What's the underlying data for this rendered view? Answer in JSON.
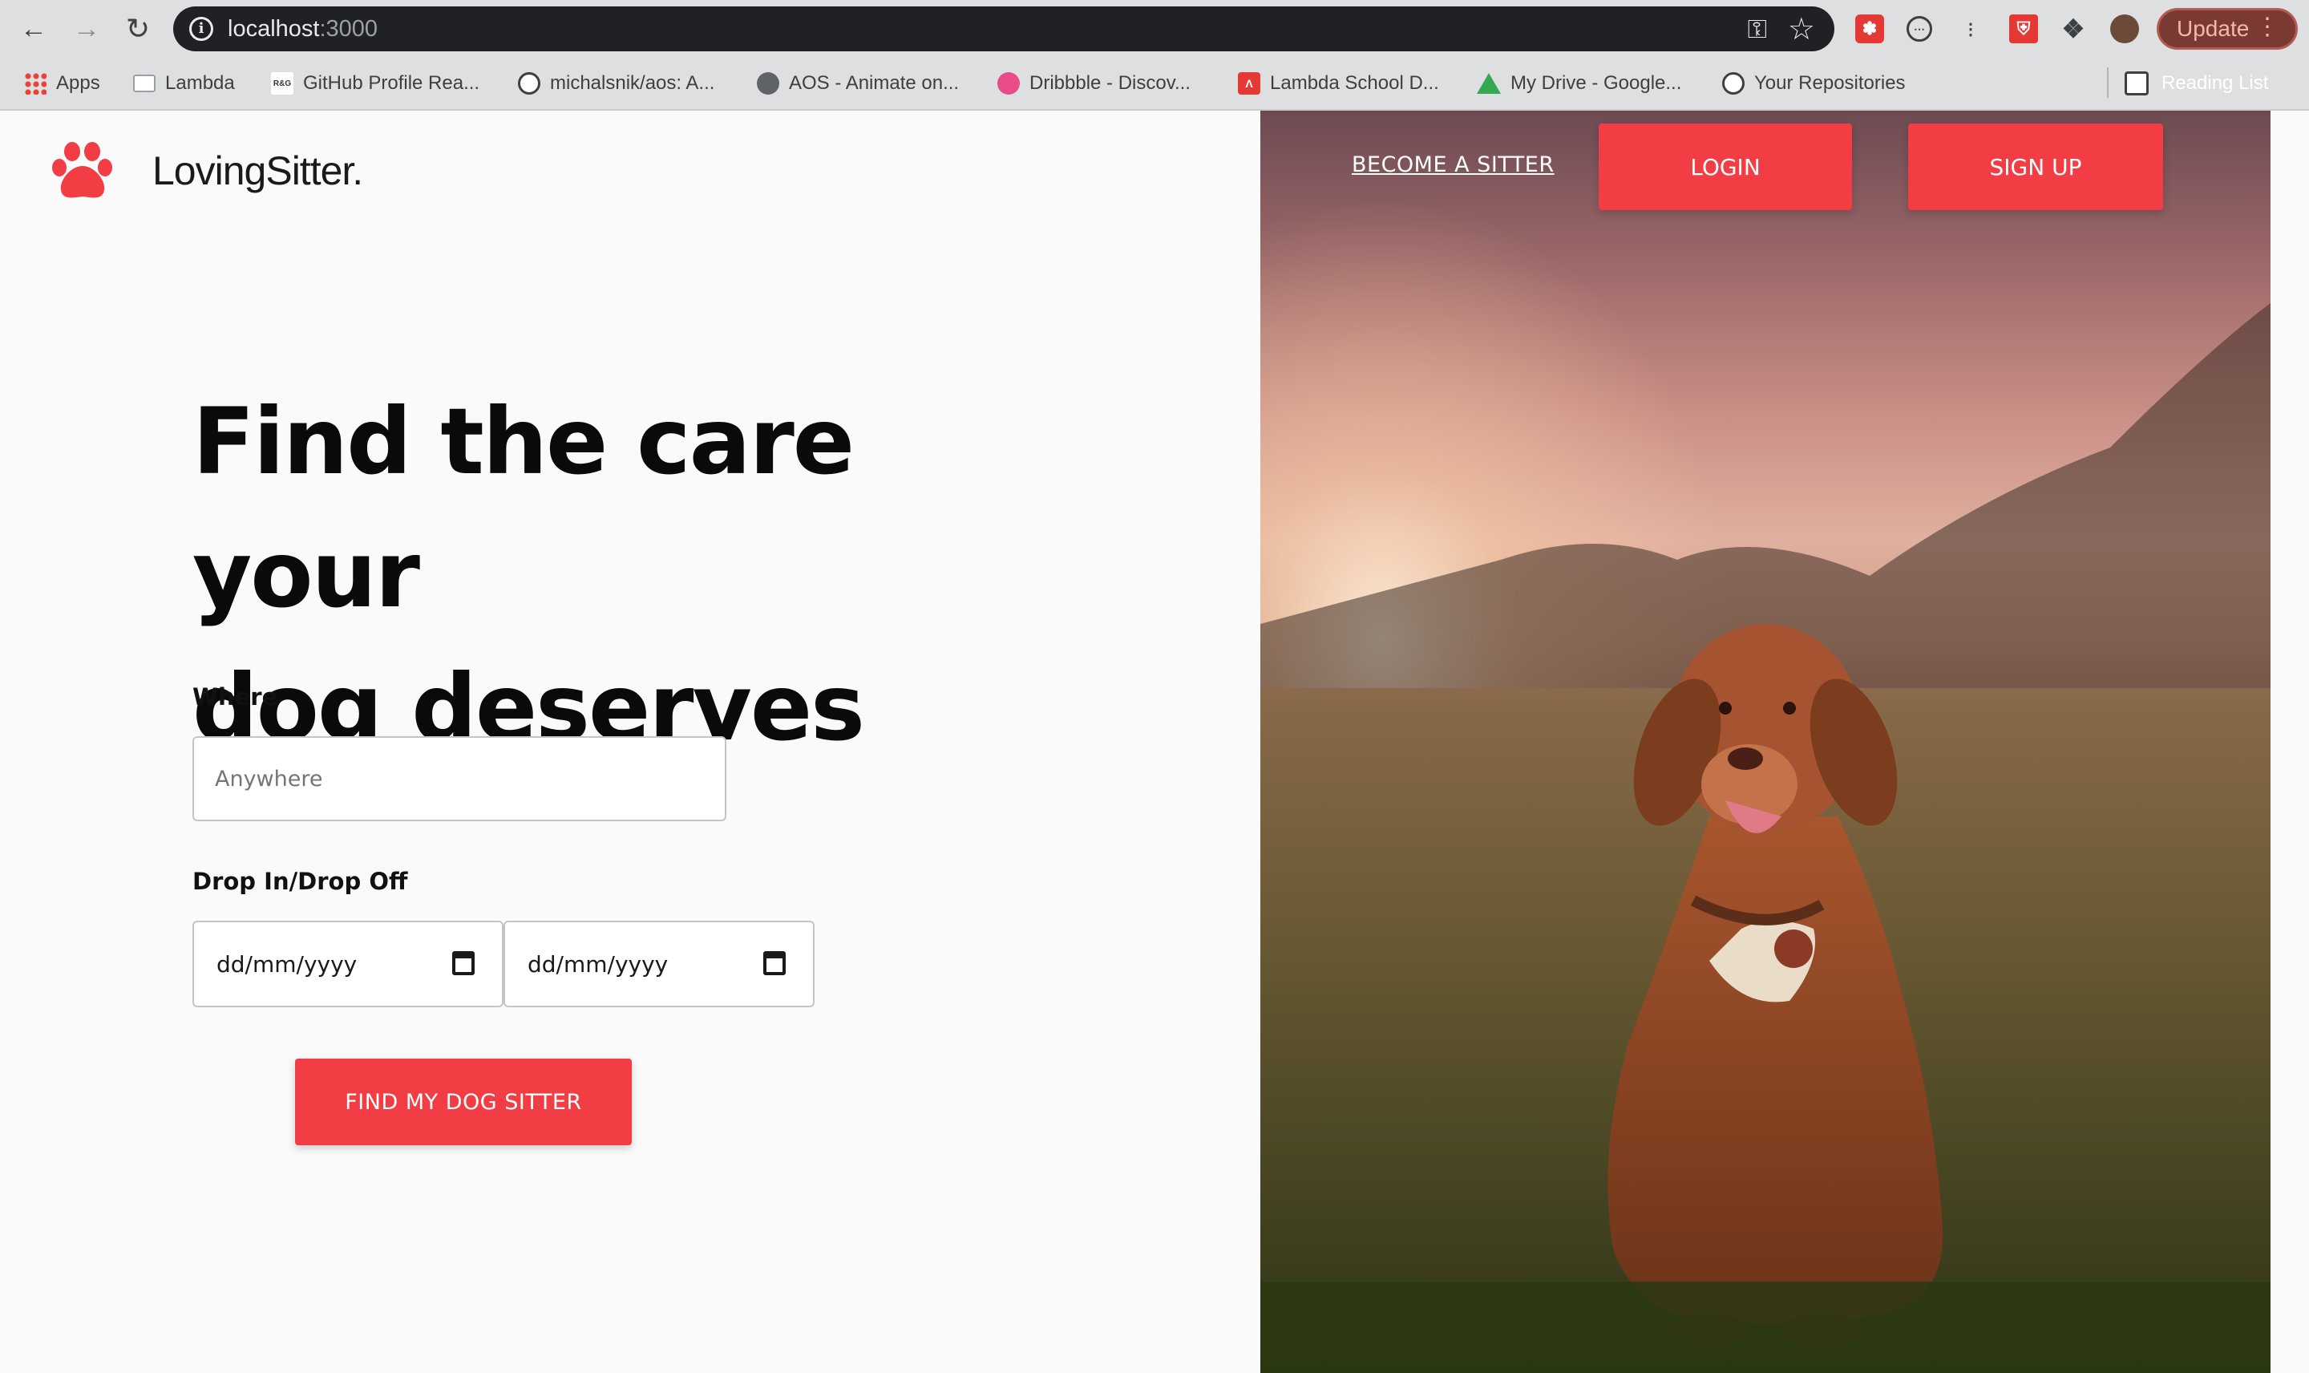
{
  "browser": {
    "url_host": "localhost",
    "url_port": ":3000",
    "update_label": "Update",
    "reading_list_label": "Reading List",
    "bookmarks": [
      {
        "label": "Apps",
        "icon": "apps-grid-icon"
      },
      {
        "label": "Lambda",
        "icon": "folder-icon"
      },
      {
        "label": "GitHub Profile Rea...",
        "icon": "rg-icon"
      },
      {
        "label": "michalsnik/aos: A...",
        "icon": "github-icon"
      },
      {
        "label": "AOS - Animate on...",
        "icon": "globe-icon"
      },
      {
        "label": "Dribbble - Discov...",
        "icon": "dribbble-icon"
      },
      {
        "label": "Lambda School D...",
        "icon": "lambda-icon"
      },
      {
        "label": "My Drive - Google...",
        "icon": "google-drive-icon"
      },
      {
        "label": "Your Repositories",
        "icon": "github-icon"
      }
    ]
  },
  "header": {
    "brand": "LovingSitter.",
    "become_sitter": "BECOME A SITTER",
    "login": "LOGIN",
    "signup": "SIGN UP"
  },
  "hero": {
    "headline_line1": "Find the care your",
    "headline_line2": "dog deserves"
  },
  "search": {
    "where_label": "Where",
    "where_placeholder": "Anywhere",
    "dates_label": "Drop In/Drop Off",
    "drop_in_placeholder": "dd/mm/yyyy",
    "drop_off_placeholder": "dd/mm/yyyy",
    "submit_label": "FIND MY DOG SITTER"
  },
  "colors": {
    "accent": "#f23d44"
  }
}
